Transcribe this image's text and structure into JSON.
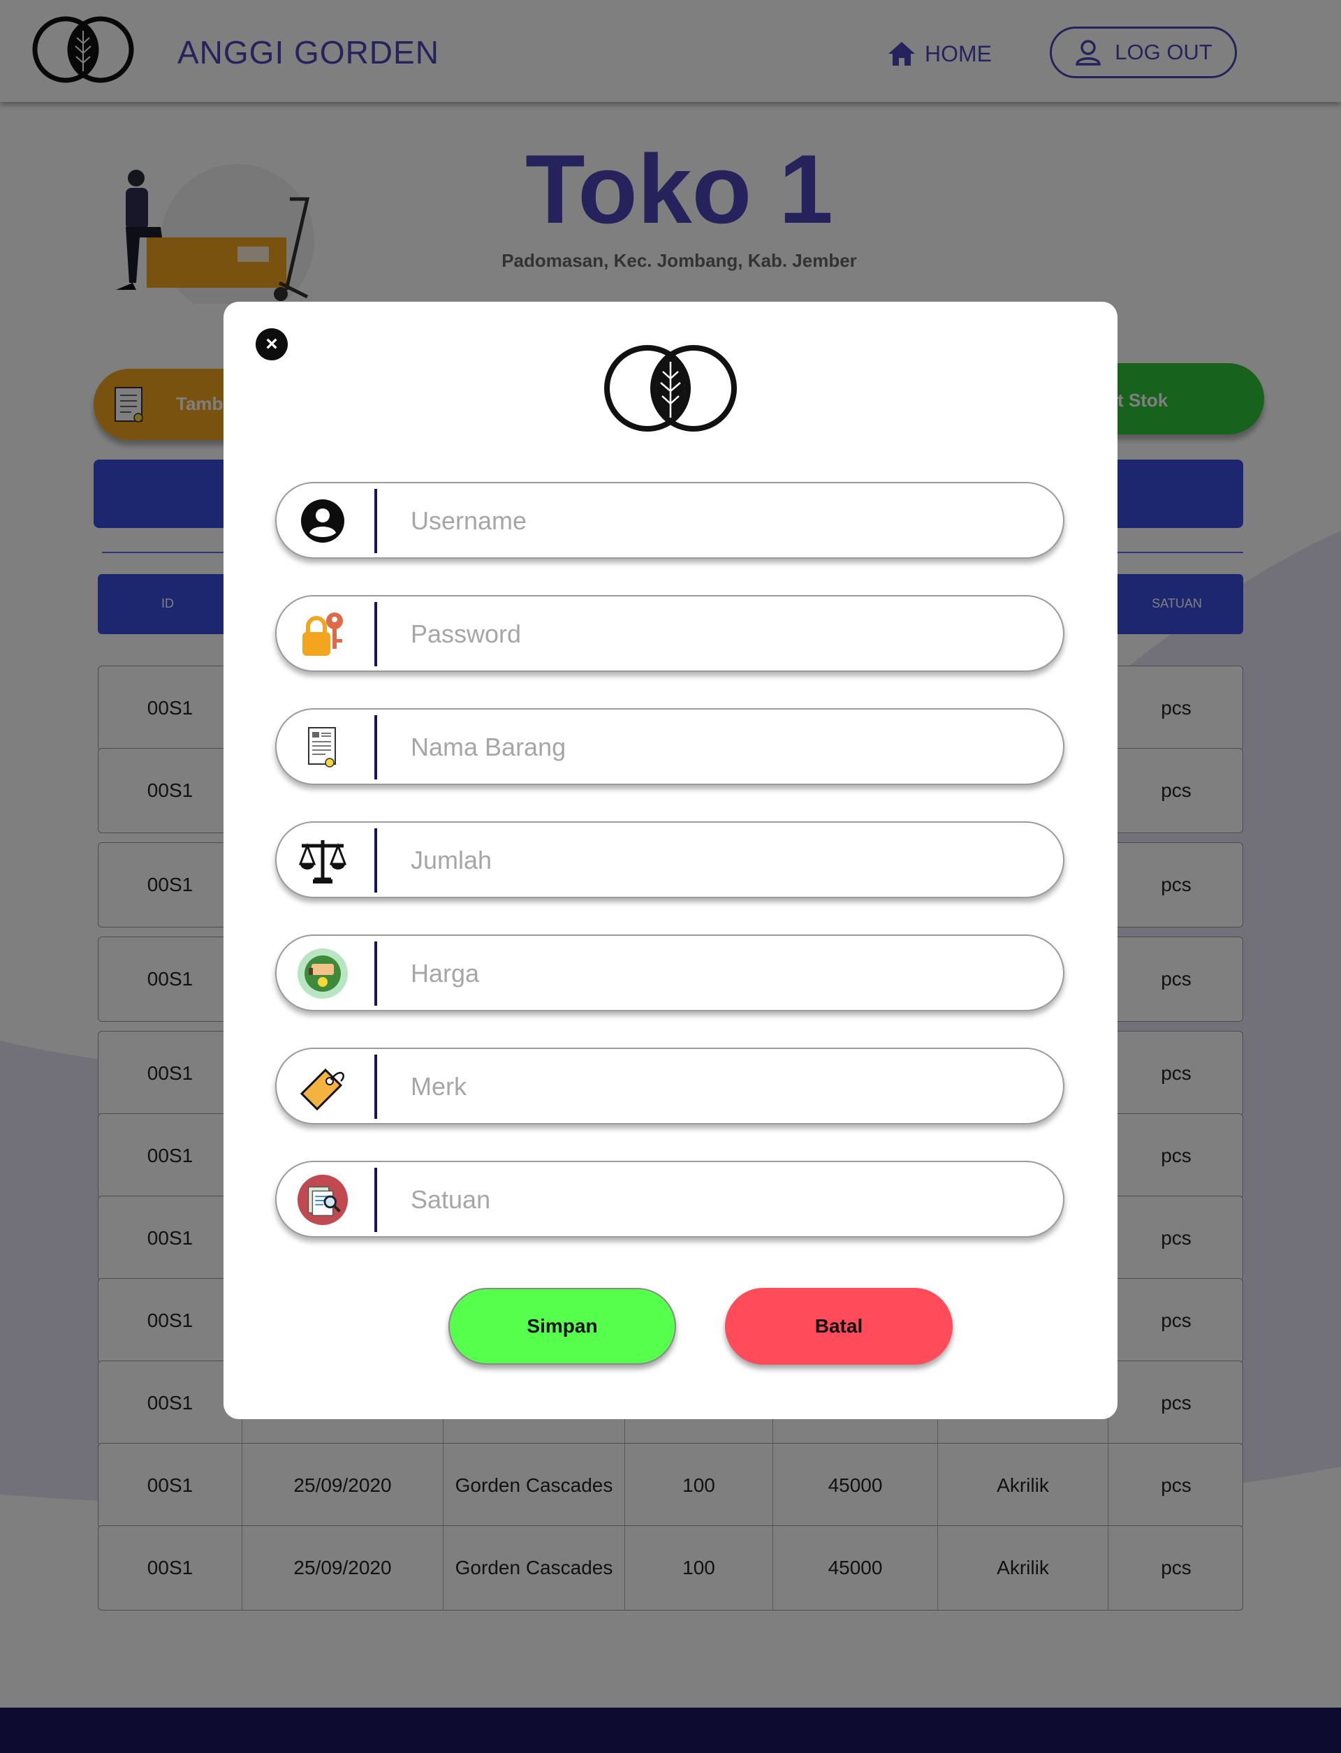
{
  "header": {
    "brand": "ANGGI GORDEN",
    "home_label": "HOME",
    "logout_label": "LOG OUT"
  },
  "store": {
    "title": "Toko 1",
    "address": "Padomasan, Kec. Jombang, Kab. Jember"
  },
  "actions": {
    "tambah_label": "Tamba",
    "stok_label": "t Stok"
  },
  "table": {
    "headers": {
      "id": "ID",
      "satuan": "SATUAN"
    },
    "rows": [
      {
        "id": "00S1",
        "date": "",
        "nama": "",
        "jumlah": "",
        "harga": "",
        "merk": "",
        "satuan": "pcs"
      },
      {
        "id": "00S1",
        "date": "",
        "nama": "",
        "jumlah": "",
        "harga": "",
        "merk": "",
        "satuan": "pcs"
      },
      {
        "id": "00S1",
        "date": "",
        "nama": "",
        "jumlah": "",
        "harga": "",
        "merk": "",
        "satuan": "pcs"
      },
      {
        "id": "00S1",
        "date": "",
        "nama": "",
        "jumlah": "",
        "harga": "",
        "merk": "",
        "satuan": "pcs"
      },
      {
        "id": "00S1",
        "date": "",
        "nama": "",
        "jumlah": "",
        "harga": "",
        "merk": "",
        "satuan": "pcs"
      },
      {
        "id": "00S1",
        "date": "",
        "nama": "",
        "jumlah": "",
        "harga": "",
        "merk": "",
        "satuan": "pcs"
      },
      {
        "id": "00S1",
        "date": "",
        "nama": "",
        "jumlah": "",
        "harga": "",
        "merk": "",
        "satuan": "pcs"
      },
      {
        "id": "00S1",
        "date": "",
        "nama": "",
        "jumlah": "",
        "harga": "",
        "merk": "",
        "satuan": "pcs"
      },
      {
        "id": "00S1",
        "date": "",
        "nama": "",
        "jumlah": "",
        "harga": "",
        "merk": "",
        "satuan": "pcs"
      },
      {
        "id": "00S1",
        "date": "25/09/2020",
        "nama": "Gorden Cascades",
        "jumlah": "100",
        "harga": "45000",
        "merk": "Akrilik",
        "satuan": "pcs"
      },
      {
        "id": "00S1",
        "date": "25/09/2020",
        "nama": "Gorden Cascades",
        "jumlah": "100",
        "harga": "45000",
        "merk": "Akrilik",
        "satuan": "pcs"
      }
    ]
  },
  "modal": {
    "close_symbol": "×",
    "fields": [
      {
        "name": "username",
        "placeholder": "Username",
        "icon": "user-circle-icon"
      },
      {
        "name": "password",
        "placeholder": "Password",
        "icon": "lock-key-icon"
      },
      {
        "name": "nama-barang",
        "placeholder": "Nama Barang",
        "icon": "document-icon"
      },
      {
        "name": "jumlah",
        "placeholder": "Jumlah",
        "icon": "scale-icon"
      },
      {
        "name": "harga",
        "placeholder": "Harga",
        "icon": "money-icon"
      },
      {
        "name": "merk",
        "placeholder": "Merk",
        "icon": "tag-icon"
      },
      {
        "name": "satuan",
        "placeholder": "Satuan",
        "icon": "search-document-icon"
      }
    ],
    "save_label": "Simpan",
    "cancel_label": "Batal"
  },
  "colors": {
    "accent": "#4c47b8",
    "table_header": "#3a4fe0",
    "save": "#55ff4c",
    "cancel": "#ff4b5a",
    "footer": "#1b1760"
  }
}
